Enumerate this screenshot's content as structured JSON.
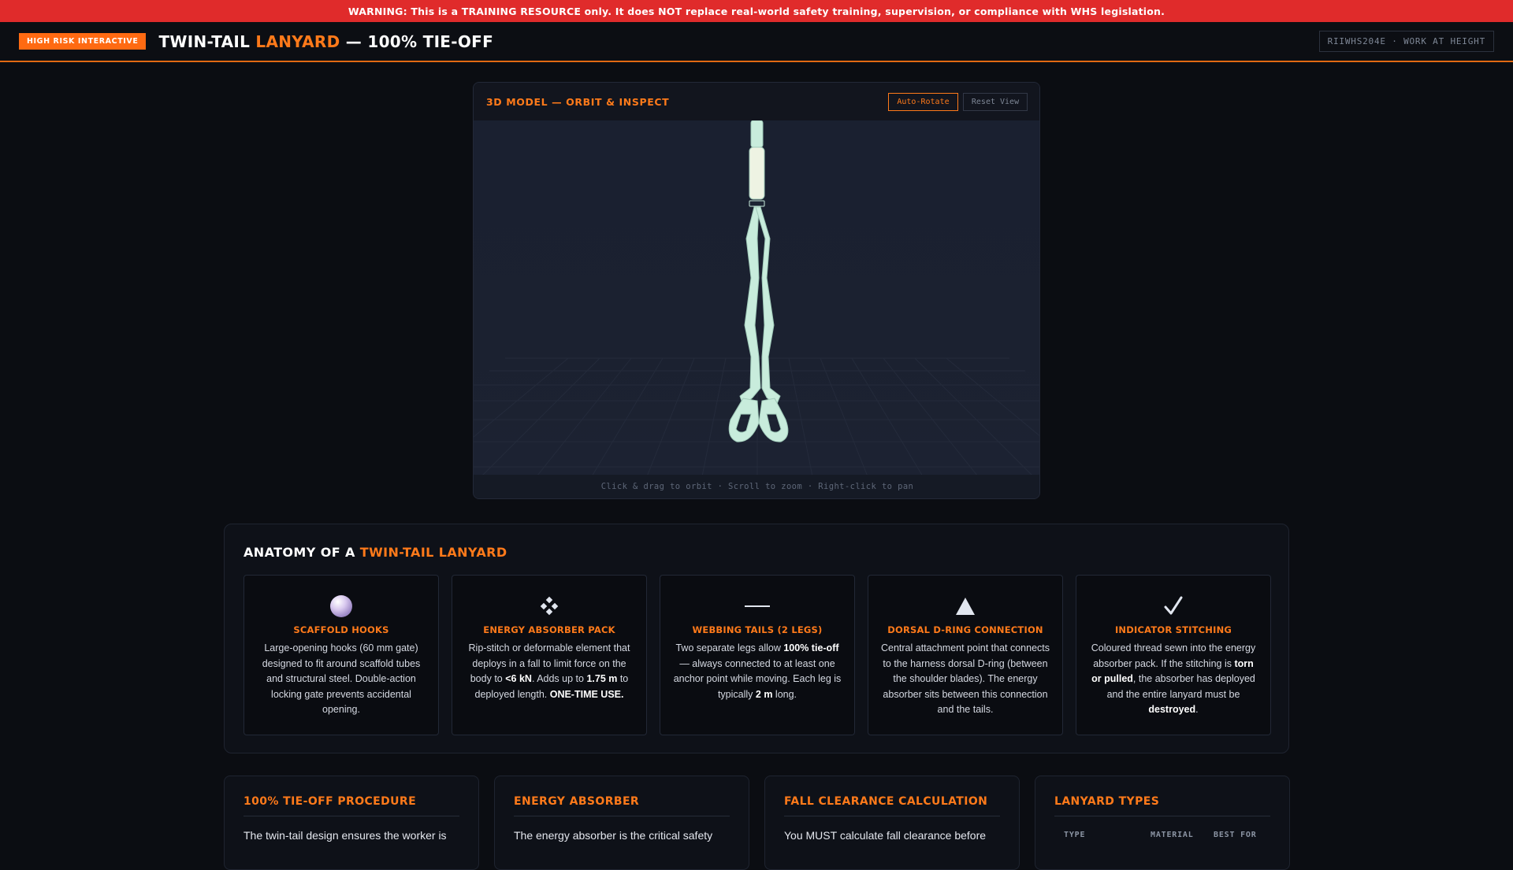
{
  "warning": "WARNING: This is a TRAINING RESOURCE only. It does NOT replace real-world safety training, supervision, or compliance with WHS legislation.",
  "header": {
    "badge": "HIGH RISK INTERACTIVE",
    "title_prefix": "TWIN-TAIL ",
    "title_accent": "LANYARD",
    "title_suffix": " — 100% TIE-OFF",
    "course_code": "RIIWHS204E · WORK AT HEIGHT"
  },
  "viewer": {
    "title": "3D MODEL — ORBIT & INSPECT",
    "auto_rotate_label": "Auto-Rotate",
    "reset_label": "Reset View",
    "hint": "Click & drag to orbit · Scroll to zoom · Right-click to pan",
    "model_color": "#c8ecdc"
  },
  "anatomy": {
    "title_prefix": "ANATOMY OF A ",
    "title_accent": "TWIN-TAIL LANYARD",
    "cards": [
      {
        "icon": "sphere-icon",
        "title": "SCAFFOLD HOOKS",
        "parts": [
          [
            "t",
            "Large-opening hooks (60 mm gate) designed to fit around scaffold tubes and structural steel. Double-action locking gate prevents accidental opening."
          ]
        ]
      },
      {
        "icon": "diamond-cluster-icon",
        "title": "ENERGY ABSORBER PACK",
        "parts": [
          [
            "t",
            "Rip-stitch or deformable element that deploys in a fall to limit force on the body to "
          ],
          [
            "b",
            "<6 kN"
          ],
          [
            "t",
            ". Adds up to "
          ],
          [
            "b",
            "1.75 m"
          ],
          [
            "t",
            " to deployed length. "
          ],
          [
            "b",
            "ONE-TIME USE."
          ]
        ]
      },
      {
        "icon": "dash-icon",
        "title": "WEBBING TAILS (2 LEGS)",
        "parts": [
          [
            "t",
            "Two separate legs allow "
          ],
          [
            "b",
            "100% tie-off"
          ],
          [
            "t",
            " — always connected to at least one anchor point while moving. Each leg is typically "
          ],
          [
            "b",
            "2 m"
          ],
          [
            "t",
            " long."
          ]
        ]
      },
      {
        "icon": "triangle-icon",
        "title": "DORSAL D-RING CONNECTION",
        "parts": [
          [
            "t",
            "Central attachment point that connects to the harness dorsal D-ring (between the shoulder blades). The energy absorber sits between this connection and the tails."
          ]
        ]
      },
      {
        "icon": "checkmark-icon",
        "title": "INDICATOR STITCHING",
        "parts": [
          [
            "t",
            "Coloured thread sewn into the energy absorber pack. If the stitching is "
          ],
          [
            "b",
            "torn or pulled"
          ],
          [
            "t",
            ", the absorber has deployed and the entire lanyard must be "
          ],
          [
            "b",
            "destroyed"
          ],
          [
            "t",
            "."
          ]
        ]
      }
    ]
  },
  "panels": [
    {
      "title": "100% TIE-OFF PROCEDURE",
      "body": "The twin-tail design ensures the worker is"
    },
    {
      "title": "ENERGY ABSORBER",
      "body": "The energy absorber is the critical safety"
    },
    {
      "title": "FALL CLEARANCE CALCULATION",
      "body": "You MUST calculate fall clearance before"
    },
    {
      "title": "LANYARD TYPES",
      "body": "",
      "columns": [
        "TYPE",
        "MATERIAL",
        "BEST FOR"
      ]
    }
  ]
}
